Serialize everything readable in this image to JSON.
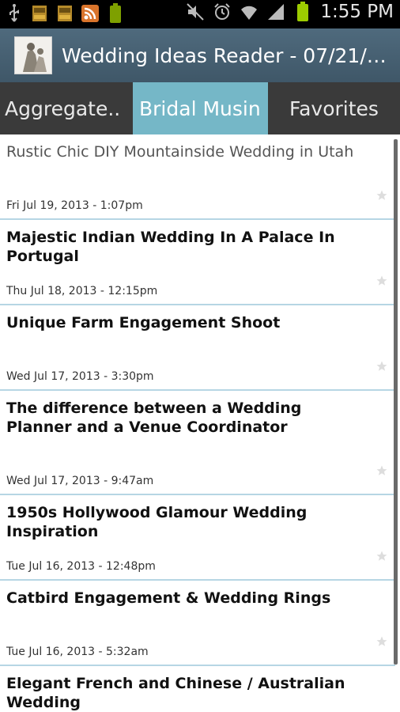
{
  "status_bar": {
    "time": "1:55 PM",
    "left_icons": [
      "usb-icon",
      "sd-card-icon",
      "sd-card-icon",
      "rss-icon",
      "battery-100-icon"
    ],
    "right_icons": [
      "mute-icon",
      "alarm-icon",
      "wifi-icon",
      "signal-icon",
      "battery-icon"
    ],
    "battery_color": "#9ccc00"
  },
  "action_bar": {
    "title": "Wedding Ideas Reader - 07/21/20..",
    "icon": "app-logo-icon",
    "color": "#46606f"
  },
  "tabs": [
    {
      "label": "Aggregate..",
      "selected": false
    },
    {
      "label": "Bridal Musin",
      "selected": true
    },
    {
      "label": "Favorites",
      "selected": false
    }
  ],
  "accent_color": "#75b7c7",
  "articles": [
    {
      "title": "Rustic Chic DIY Mountainside Wedding in Utah",
      "date": "Fri Jul 19, 2013 - 1:07pm",
      "read": true
    },
    {
      "title": "Majestic Indian Wedding In A Palace In Portugal",
      "date": "Thu Jul 18, 2013 - 12:15pm",
      "read": false
    },
    {
      "title": "Unique Farm Engagement Shoot",
      "date": "Wed Jul 17, 2013 - 3:30pm",
      "read": false
    },
    {
      "title": "The difference between a Wedding Planner and a Venue Coordinator",
      "date": "Wed Jul 17, 2013 - 9:47am",
      "read": false
    },
    {
      "title": "1950s Hollywood Glamour Wedding Inspiration",
      "date": "Tue Jul 16, 2013 - 12:48pm",
      "read": false
    },
    {
      "title": "Catbird Engagement & Wedding Rings",
      "date": "Tue Jul 16, 2013 - 5:32am",
      "read": false
    },
    {
      "title": "Elegant French and Chinese / Australian Wedding",
      "date": "",
      "read": false
    }
  ]
}
